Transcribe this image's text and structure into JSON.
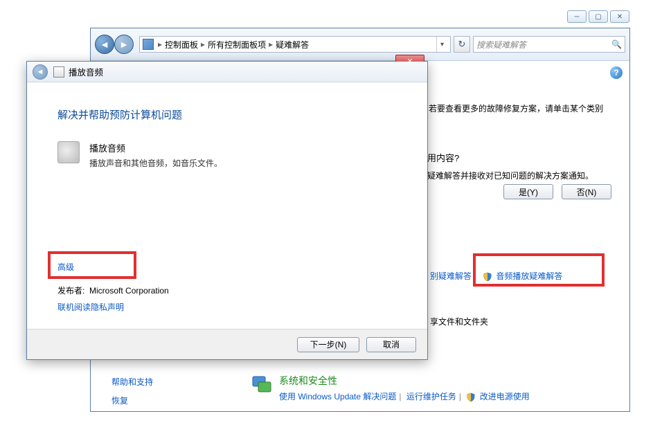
{
  "bg_window": {
    "breadcrumb": [
      "控制面板",
      "所有控制面板项",
      "疑难解答"
    ],
    "search_placeholder": "搜索疑难解答",
    "more_solutions_text": "若要查看更多的故障修复方案，请单击某个类别",
    "subbox_title": "用内容?",
    "subbox_desc": "疑难解答并接收对已知问题的解决方案通知。",
    "yes_label": "是(Y)",
    "no_label": "否(N)",
    "link_left": "别疑难解答",
    "link_right": "音频播放疑难解答",
    "share_text": "享文件和文件夹",
    "sidebar": {
      "help": "帮助和支持",
      "recovery": "恢复"
    },
    "category": {
      "title": "系统和安全性",
      "l1": "使用 Windows Update 解决问题",
      "l2": "运行维护任务",
      "l3": "改进电源使用"
    }
  },
  "dialog": {
    "title": "播放音频",
    "heading": "解决并帮助预防计算机问题",
    "item_title": "播放音频",
    "item_desc": "播放声音和其他音频，如音乐文件。",
    "advanced": "高级",
    "publisher_label": "发布者:",
    "publisher_value": "Microsoft Corporation",
    "privacy": "联机阅读隐私声明",
    "next": "下一步(N)",
    "cancel": "取消"
  }
}
